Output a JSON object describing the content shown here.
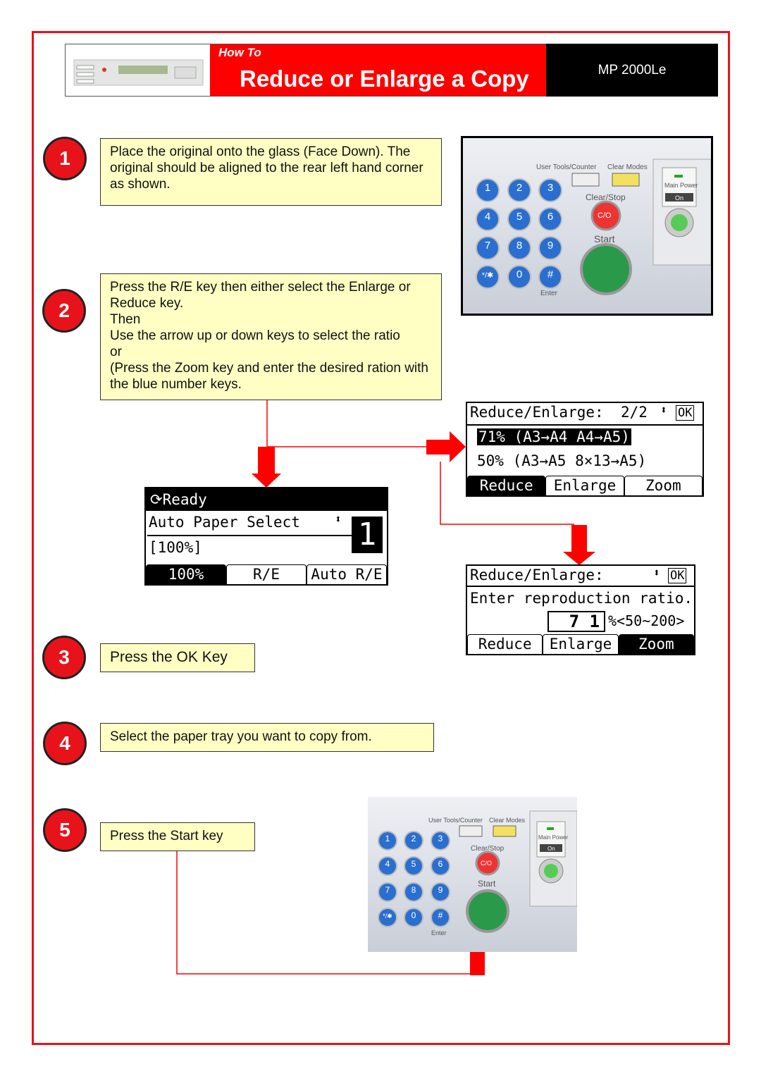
{
  "header": {
    "how_to": "How To",
    "title": "Reduce or Enlarge a Copy",
    "model": "MP 2000Le",
    "image": "control-panel-thumbnail"
  },
  "steps": [
    {
      "number": "1",
      "text": "Place the original onto the glass (Face Down). The original should be aligned to the rear left hand corner as shown."
    },
    {
      "number": "2",
      "lines": [
        "Press the R/E key then either select the Enlarge or Reduce key.",
        "Then",
        "Use the arrow up or down keys to select the ratio",
        "or",
        "(Press the Zoom key and enter the desired ration with the blue number keys."
      ]
    },
    {
      "number": "3",
      "text": "Press the OK Key"
    },
    {
      "number": "4",
      "text": "Select the paper tray you want to copy from."
    },
    {
      "number": "5",
      "text": "Press the Start key"
    }
  ],
  "keypad": {
    "user_tools": "User Tools/Counter",
    "clear_modes": "Clear Modes",
    "clear_stop": "Clear/Stop",
    "clear_stop_key": "C/O",
    "start": "Start",
    "main_power": "Main Power",
    "on": "On",
    "enter": "Enter",
    "keys": [
      "1",
      "2",
      "3",
      "4",
      "5",
      "6",
      "7",
      "8",
      "9",
      "*/✱",
      "0",
      "#"
    ]
  },
  "lcd_ready": {
    "status": "Ready",
    "line1": "Auto Paper Select",
    "line2": "[100%]",
    "tray": "1",
    "tabs": [
      "100%",
      "R/E",
      "Auto R/E"
    ],
    "active_tab": 0
  },
  "lcd_reduce": {
    "title": "Reduce/Enlarge:",
    "page": "2/2",
    "ok": "OK",
    "options": [
      "71% (A3→A4 A4→A5)",
      "50% (A3→A5 8×13→A5)"
    ],
    "selected": 0,
    "tabs": [
      "Reduce",
      "Enlarge",
      "Zoom"
    ],
    "active_tab": 0
  },
  "lcd_zoom": {
    "title": "Reduce/Enlarge:",
    "ok": "OK",
    "prompt": "Enter reproduction ratio.",
    "value": "7 1",
    "range": "%<50~200>",
    "tabs": [
      "Reduce",
      "Enlarge",
      "Zoom"
    ],
    "active_tab": 2
  },
  "colors": {
    "accent": "#ff0000",
    "box": "#ffffc4",
    "key_blue": "#2a6fd0"
  }
}
